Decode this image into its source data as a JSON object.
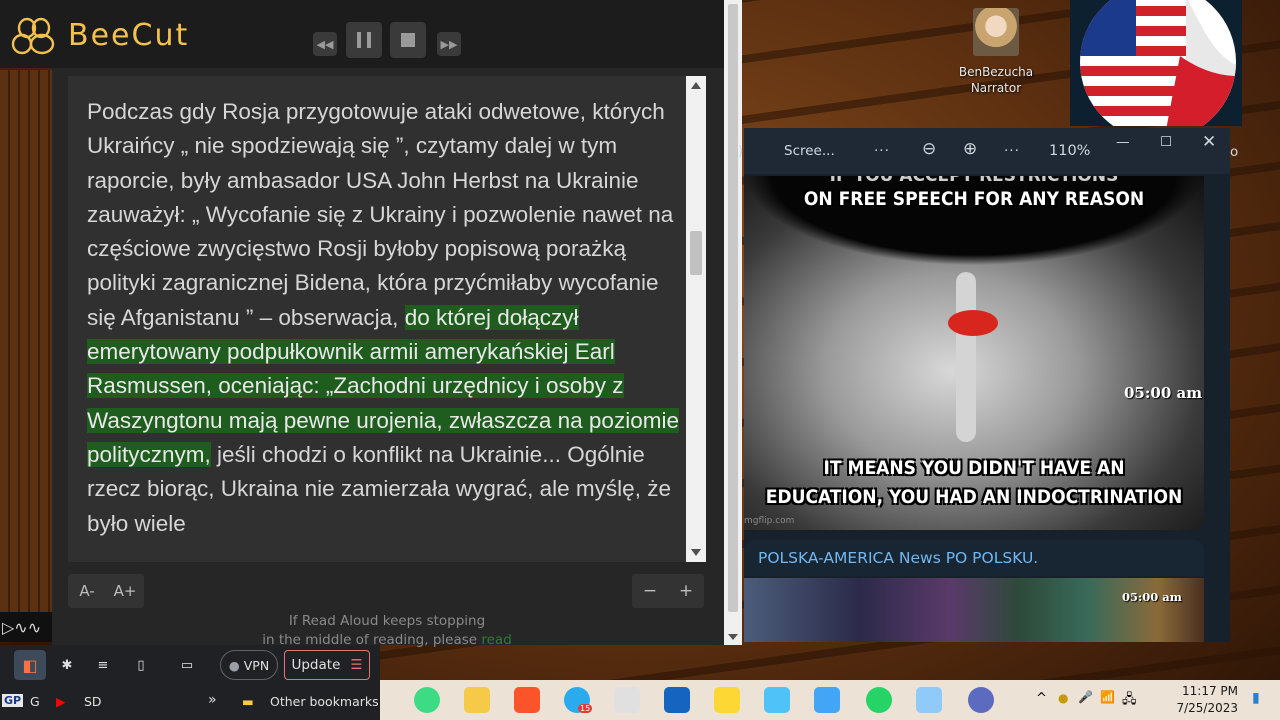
{
  "beecut": {
    "app_name": "BeeCut"
  },
  "reader": {
    "text_before": "Podczas gdy Rosja przygotowuje ataki odwetowe, których Ukraińcy „ nie spodziewają się ”, czytamy dalej w tym raporcie, były ambasador USA John Herbst na Ukrainie zauważył: „ Wycofanie się z Ukrainy i pozwolenie nawet na częściowe zwycięstwo Rosji byłoby popisową porażką polityki zagranicznej Bidena, która przyćmiłaby wycofanie się Afganistanu ” – obserwacja, ",
    "text_highlight": "do której dołączył emerytowany podpułkownik armii amerykańskiej Earl Rasmussen, oceniając: „Zachodni urzędnicy i osoby z Waszyngtonu mają pewne urojenia, zwłaszcza na poziomie politycznym,",
    "text_after": " jeśli chodzi o konflikt na Ukrainie... Ogólnie rzecz biorąc, Ukraina nie zamierzała wygrać, ale myślę, że było wiele",
    "font_decrease": "A-",
    "font_increase": "A+",
    "speed_decrease": "−",
    "speed_increase": "+",
    "help_line1": "If Read Aloud keeps stopping",
    "help_line2": "in the middle of reading, please ",
    "help_link": "read"
  },
  "desktop": {
    "narrator_name": "BenBezucha",
    "narrator_role": "Narrator"
  },
  "telegram": {
    "title": "Scree...",
    "zoom": "110%",
    "dots": "···",
    "zoom_out": "⊖",
    "zoom_in": "⊕",
    "edge_glyph": ")",
    "right_glyph": "o",
    "meme_ghost": "IF YOU ACCEPT RESTRICTIONS",
    "meme_top": "ON FREE SPEECH FOR ANY REASON",
    "meme_bottom_1": "IT MEANS YOU DIDN'T HAVE AN",
    "meme_bottom_2": "EDUCATION, YOU HAD AN INDOCTRINATION",
    "watermark": "mgflip.com",
    "time1": "05:00 am",
    "channel": "POLSKA-AMERICA News PO POLSKU.",
    "time2": "05:00 am"
  },
  "browser": {
    "vpn": "VPN",
    "update": "Update",
    "update_menu": "☰",
    "bm_gp": "GP",
    "bm_g": "G",
    "bm_sd": "SD",
    "bm_more": "»",
    "other_bookmarks": "Other bookmarks",
    "sine_glyphs": "▷∿∿"
  },
  "taskbar": {
    "time": "11:17 PM",
    "date": "7/25/2023",
    "telegram_badge": "15",
    "tray_chevron": "^",
    "tray_mic": "🎤",
    "tray_wifi": "📶",
    "tray_net": "🖧",
    "tray_notify": "▮"
  },
  "colors": {
    "beecut_yellow": "#f2c14e",
    "highlight_green": "#1f5d1f",
    "telegram_link": "#71b7f0",
    "update_border": "#e57373"
  }
}
